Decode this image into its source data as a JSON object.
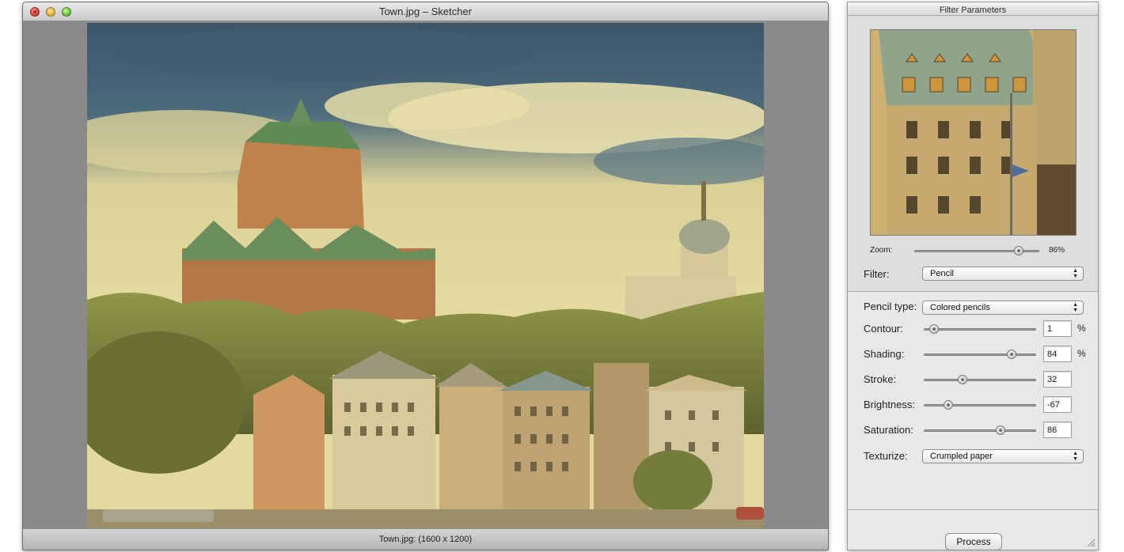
{
  "main_window": {
    "title": "Town.jpg – Sketcher",
    "status": "Town.jpg: (1600 x 1200)"
  },
  "panel": {
    "title": "Filter Parameters",
    "zoom_label": "Zoom:",
    "zoom_value": "86%",
    "zoom_fraction": 0.86,
    "filter_label": "Filter:",
    "filter_value": "Pencil",
    "pencil_type_label": "Pencil type:",
    "pencil_type_value": "Colored pencils",
    "params": [
      {
        "label": "Contour:",
        "value": "1",
        "unit": "%",
        "fraction": 0.05
      },
      {
        "label": "Shading:",
        "value": "84",
        "unit": "%",
        "fraction": 0.81
      },
      {
        "label": "Stroke:",
        "value": "32",
        "unit": "",
        "fraction": 0.33
      },
      {
        "label": "Brightness:",
        "value": "-67",
        "unit": "",
        "fraction": 0.19
      },
      {
        "label": "Saturation:",
        "value": "86",
        "unit": "",
        "fraction": 0.7
      }
    ],
    "texturize_label": "Texturize:",
    "texturize_value": "Crumpled paper",
    "process_label": "Process"
  },
  "icons": {
    "close": "close-icon",
    "minimize": "minimize-icon",
    "zoom": "zoom-icon",
    "popup_arrows": "up-down-arrows-icon",
    "resize_grip": "resize-grip-icon"
  },
  "colors": {
    "canvas_bg": "#8a8a8a",
    "panel_bg": "#e8e8e8"
  }
}
